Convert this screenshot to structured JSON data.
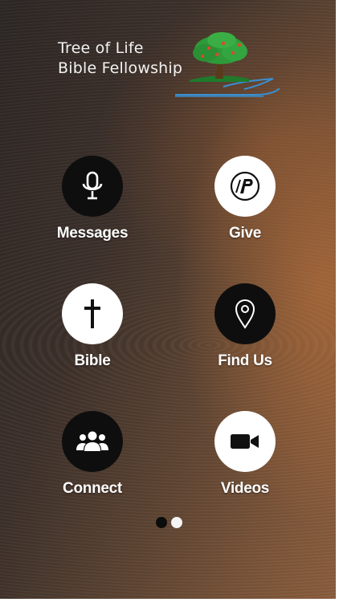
{
  "logo": {
    "line1": "Tree of Life",
    "line2": "Bible Fellowship"
  },
  "tiles": [
    {
      "label": "Messages",
      "icon": "microphone-icon",
      "style": "dark"
    },
    {
      "label": "Give",
      "icon": "pushpay-icon",
      "style": "light"
    },
    {
      "label": "Bible",
      "icon": "cross-icon",
      "style": "light"
    },
    {
      "label": "Find Us",
      "icon": "map-pin-icon",
      "style": "dark"
    },
    {
      "label": "Connect",
      "icon": "people-icon",
      "style": "dark"
    },
    {
      "label": "Videos",
      "icon": "video-camera-icon",
      "style": "light"
    }
  ],
  "pager": {
    "pages": 2,
    "current": 2
  },
  "colors": {
    "dark_circle": "#0e0e0e",
    "light_circle": "#ffffff",
    "logo_green": "#2e9a3a",
    "river_blue": "#3a8fd0"
  }
}
